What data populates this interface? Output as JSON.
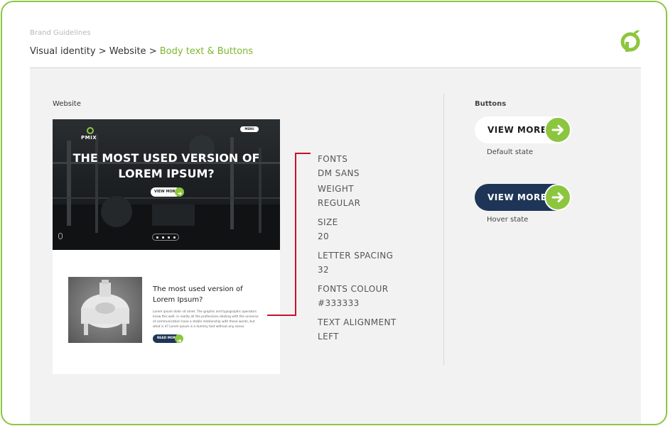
{
  "header": {
    "brand_label": "Brand Guidelines",
    "breadcrumb": [
      "Visual identity",
      "Website"
    ],
    "breadcrumb_separator": ">",
    "breadcrumb_current": "Body text & Buttons"
  },
  "sections": {
    "website_label": "Website",
    "buttons_label": "Buttons"
  },
  "mockup": {
    "hero_title": "THE MOST USED VERSION OF LOREM IPSUM?",
    "logo_text": "PMIX",
    "menu_label": "MENU",
    "hero_button": "VIEW MORE",
    "body_title": "The most used version of Lorem Ipsum?",
    "body_text": "Lorem ipsum dolor sit amet. The graphic and typographic operators know this well, in reality all the professions dealing with the universe of communication have a stable relationship with these words, but what is it? Lorem ipsum is a dummy text without any sense.",
    "read_button": "READ MORE"
  },
  "specs": [
    {
      "key": "FONTS",
      "value": "DM SANS"
    },
    {
      "key": "WEIGHT",
      "value": "REGULAR"
    },
    {
      "key": "SIZE",
      "value": "20"
    },
    {
      "key": "LETTER SPACING",
      "value": "32"
    },
    {
      "key": "FONTS COLOUR",
      "value": "#333333"
    },
    {
      "key": "TEXT ALIGNMENT",
      "value": "LEFT"
    }
  ],
  "buttons": {
    "default_label": "VIEW MORE",
    "default_state": "Default state",
    "hover_label": "VIEW MORE",
    "hover_state": "Hover state"
  },
  "colors": {
    "accent_green": "#8cc63f",
    "navy": "#1f3557",
    "callout_red": "#c8102e",
    "text": "#333333"
  }
}
